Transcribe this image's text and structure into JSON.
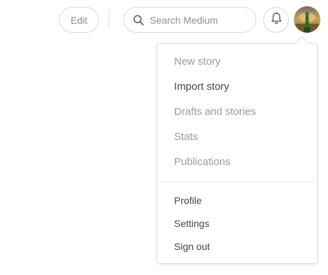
{
  "header": {
    "edit_label": "Edit",
    "search_placeholder": "Search Medium",
    "notifications_icon": "bell-icon",
    "avatar_icon": "user-avatar"
  },
  "menu": {
    "primary_items": [
      {
        "label": "New story",
        "style": "muted"
      },
      {
        "label": "Import story",
        "style": "dark"
      },
      {
        "label": "Drafts and stories",
        "style": "muted"
      },
      {
        "label": "Stats",
        "style": "muted"
      },
      {
        "label": "Publications",
        "style": "muted"
      }
    ],
    "secondary_items": [
      {
        "label": "Profile"
      },
      {
        "label": "Settings"
      },
      {
        "label": "Sign out"
      }
    ]
  },
  "colors": {
    "muted_text": "#9a9a9a",
    "dark_text": "#444444",
    "border": "#d9d9d9"
  }
}
